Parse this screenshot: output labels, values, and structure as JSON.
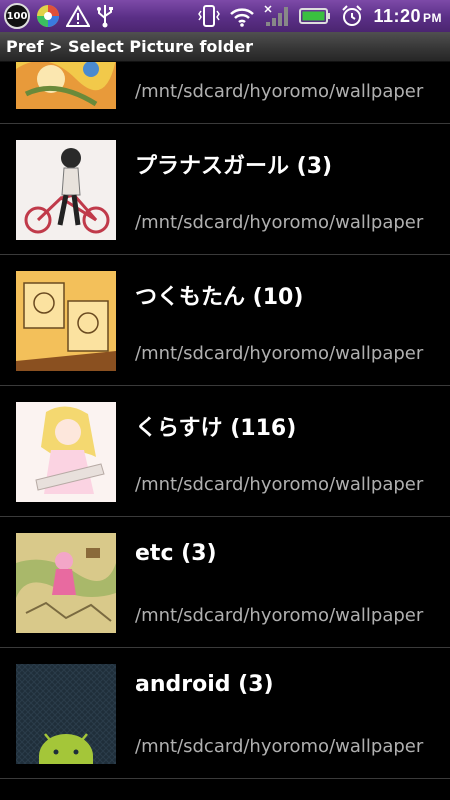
{
  "status_bar": {
    "battery_level": "100",
    "time": "11:20",
    "ampm": "PM",
    "bar_color": "#5a2f86",
    "icons": [
      "battery-badge",
      "color-wheel-icon",
      "warning-icon",
      "usb-icon",
      "vibrate-icon",
      "wifi-icon",
      "signal-icon",
      "battery-icon",
      "alarm-icon"
    ]
  },
  "title_bar": {
    "title": "Pref > Select Picture folder"
  },
  "folders": [
    {
      "name": "",
      "path": "/mnt/sdcard/hyoromo/wallpaper",
      "thumb_icon": "yellow-anime-thumbnail"
    },
    {
      "name": "プラナスガール (3)",
      "path": "/mnt/sdcard/hyoromo/wallpaper",
      "thumb_icon": "girl-on-bicycle-thumbnail"
    },
    {
      "name": "つくもたん (10)",
      "path": "/mnt/sdcard/hyoromo/wallpaper",
      "thumb_icon": "sketch-comic-thumbnail"
    },
    {
      "name": "くらすけ (116)",
      "path": "/mnt/sdcard/hyoromo/wallpaper",
      "thumb_icon": "blonde-girl-thumbnail"
    },
    {
      "name": "etc (3)",
      "path": "/mnt/sdcard/hyoromo/wallpaper",
      "thumb_icon": "fantasy-map-thumbnail"
    },
    {
      "name": "android (3)",
      "path": "/mnt/sdcard/hyoromo/wallpaper",
      "thumb_icon": "android-robot-thumbnail"
    }
  ]
}
